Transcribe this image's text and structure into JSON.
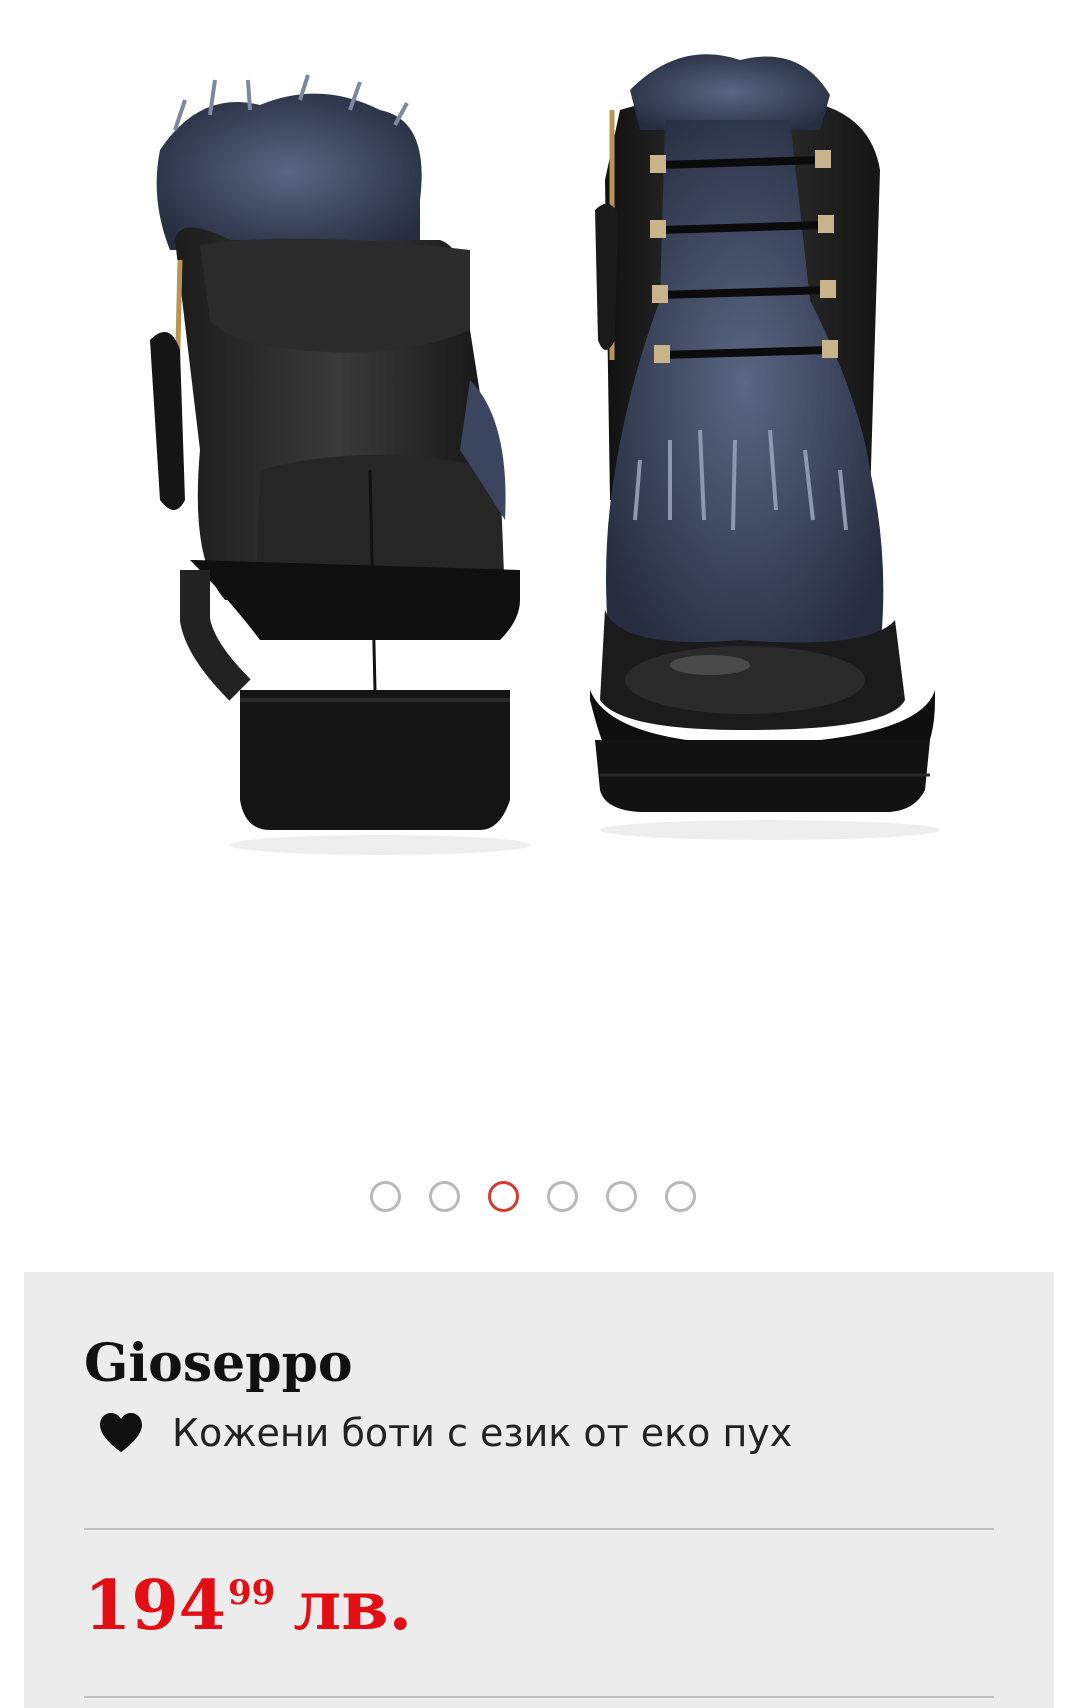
{
  "gallery": {
    "image_alt": "Gioseppo boots",
    "pages": [
      {
        "label": "slide-1",
        "active": false
      },
      {
        "label": "slide-2",
        "active": false
      },
      {
        "label": "slide-3",
        "active": true
      },
      {
        "label": "slide-4",
        "active": false
      },
      {
        "label": "slide-5",
        "active": false
      },
      {
        "label": "slide-6",
        "active": false
      }
    ],
    "active_color": "#d23b30",
    "inactive_color": "#b9b9b9"
  },
  "product": {
    "brand": "Gioseppo",
    "name": "Кожени боти с език от еко пух",
    "favorite_icon": "heart-icon",
    "price": {
      "integer": "194",
      "decimal": "99",
      "currency": "лв."
    },
    "price_color": "#e30d14",
    "card_color": "#ececec"
  }
}
